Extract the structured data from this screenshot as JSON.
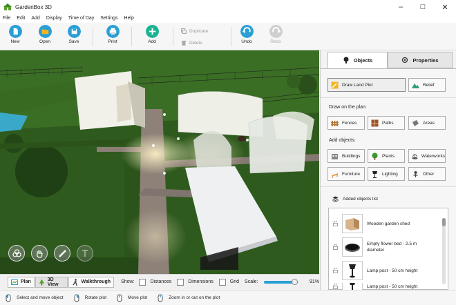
{
  "window": {
    "title": "GardenBox 3D"
  },
  "menu": [
    "File",
    "Edit",
    "Add",
    "Display",
    "Time of Day",
    "Settings",
    "Help"
  ],
  "toolbar": {
    "new": "New",
    "open": "Open",
    "save": "Save",
    "print": "Print",
    "add": "Add",
    "duplicate": "Duplicate",
    "delete": "Delete",
    "undo": "Undo",
    "redo": "Redo"
  },
  "viewbar": {
    "plan": "Plan",
    "view3d": "3D View",
    "walkthrough": "Walkthrough",
    "show": "Show:",
    "distances": "Distances",
    "dimensions": "Dimensions",
    "grid": "Grid",
    "scale": "Scale:",
    "scale_value": "91%",
    "scale_fraction": 0.91
  },
  "status": {
    "select": "Select and move object",
    "rotate": "Rotate plot",
    "move": "Move plot",
    "zoom": "Zoom in or out on the plot"
  },
  "panel": {
    "tab_objects": "Objects",
    "tab_properties": "Properties",
    "draw_land": "Draw Land Plot",
    "relief": "Relief",
    "draw_on_plan": "Draw on the plan:",
    "fences": "Fences",
    "paths": "Paths",
    "areas": "Areas",
    "add_objects": "Add objects:",
    "buildings": "Buildings",
    "plants": "Plants",
    "waterworks": "Waterworks",
    "furniture": "Furniture",
    "lighting": "Lighting",
    "other": "Other",
    "added_list": "Added objects list",
    "items": [
      {
        "label": "Wooden garden shed"
      },
      {
        "label": "Empty flower bed - 2.5 m diameter"
      },
      {
        "label": "Lamp post - 50 cm height"
      },
      {
        "label": "Lamp post - 50 cm height"
      }
    ]
  },
  "colors": {
    "accent": "#1ab394",
    "blue": "#2a9fd6",
    "grass": "#2e5a1f"
  }
}
